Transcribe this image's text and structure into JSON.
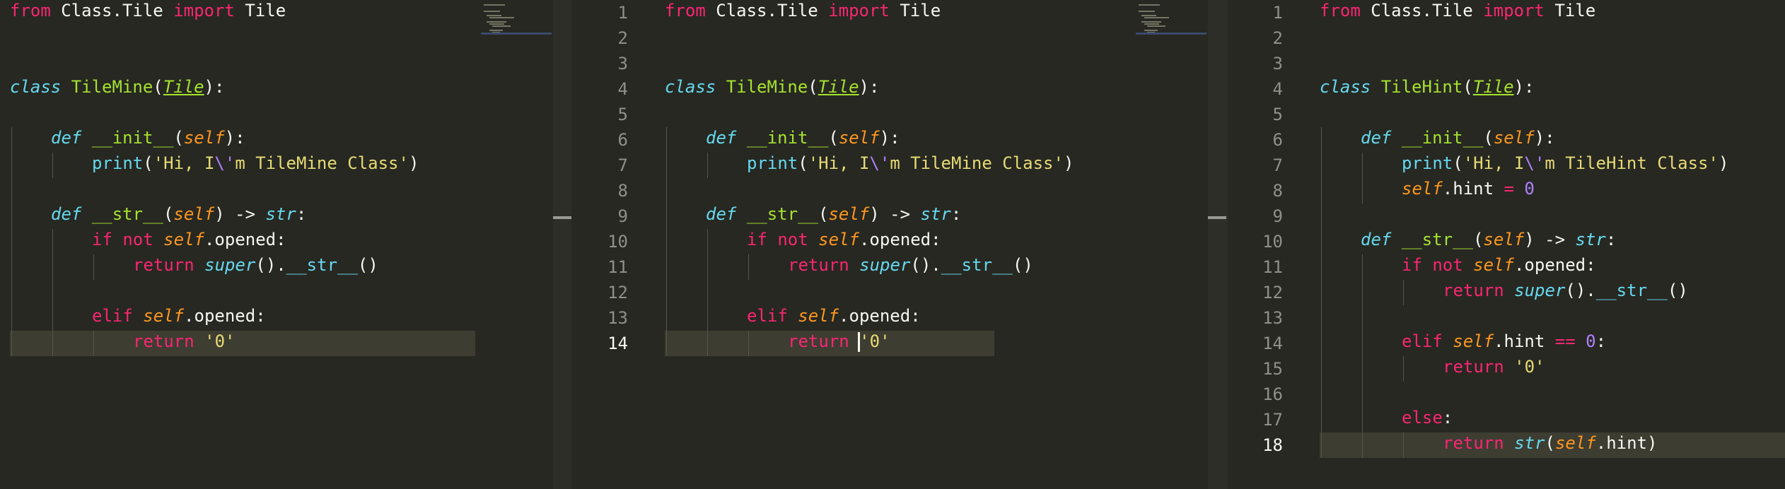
{
  "panes": [
    {
      "id": "left",
      "show_line_numbers": false,
      "line_numbers": [],
      "active_line": 14,
      "highlighted_line": 14,
      "has_minimap": true,
      "lines": [
        {
          "n": 1,
          "indent": 0,
          "tokens": [
            {
              "t": "from",
              "c": "kw"
            },
            {
              "t": " Class.Tile "
            },
            {
              "t": "import",
              "c": "kw"
            },
            {
              "t": " Tile"
            }
          ]
        },
        {
          "n": 2,
          "indent": 0,
          "tokens": []
        },
        {
          "n": 3,
          "indent": 0,
          "tokens": []
        },
        {
          "n": 4,
          "indent": 0,
          "tokens": [
            {
              "t": "class",
              "c": "st"
            },
            {
              "t": " "
            },
            {
              "t": "TileMine",
              "c": "fn"
            },
            {
              "t": "("
            },
            {
              "t": "Tile",
              "c": "inh"
            },
            {
              "t": "):"
            }
          ]
        },
        {
          "n": 5,
          "indent": 0,
          "tokens": []
        },
        {
          "n": 6,
          "indent": 1,
          "tokens": [
            {
              "t": "def",
              "c": "st"
            },
            {
              "t": " "
            },
            {
              "t": "__init__",
              "c": "fn"
            },
            {
              "t": "("
            },
            {
              "t": "self",
              "c": "prm"
            },
            {
              "t": "):"
            }
          ]
        },
        {
          "n": 7,
          "indent": 2,
          "tokens": [
            {
              "t": "print",
              "c": "bi"
            },
            {
              "t": "("
            },
            {
              "t": "'Hi, I",
              "c": "stt"
            },
            {
              "t": "\\'",
              "c": "esc"
            },
            {
              "t": "m TileMine Class'",
              "c": "stt"
            },
            {
              "t": ")"
            }
          ]
        },
        {
          "n": 8,
          "indent": 0,
          "tokens": []
        },
        {
          "n": 9,
          "indent": 1,
          "tokens": [
            {
              "t": "def",
              "c": "st"
            },
            {
              "t": " "
            },
            {
              "t": "__str__",
              "c": "fn"
            },
            {
              "t": "("
            },
            {
              "t": "self",
              "c": "prm"
            },
            {
              "t": ") -> "
            },
            {
              "t": "str",
              "c": "st"
            },
            {
              "t": ":"
            }
          ]
        },
        {
          "n": 10,
          "indent": 2,
          "tokens": [
            {
              "t": "if",
              "c": "kw"
            },
            {
              "t": " "
            },
            {
              "t": "not",
              "c": "kw"
            },
            {
              "t": " "
            },
            {
              "t": "self",
              "c": "sf"
            },
            {
              "t": ".opened:"
            }
          ]
        },
        {
          "n": 11,
          "indent": 3,
          "tokens": [
            {
              "t": "return",
              "c": "kw"
            },
            {
              "t": " "
            },
            {
              "t": "super",
              "c": "st"
            },
            {
              "t": "()."
            },
            {
              "t": "__str__",
              "c": "mag"
            },
            {
              "t": "()"
            }
          ]
        },
        {
          "n": 12,
          "indent": 0,
          "tokens": []
        },
        {
          "n": 13,
          "indent": 2,
          "tokens": [
            {
              "t": "elif",
              "c": "kw"
            },
            {
              "t": " "
            },
            {
              "t": "self",
              "c": "sf"
            },
            {
              "t": ".opened:"
            }
          ]
        },
        {
          "n": 14,
          "indent": 3,
          "tokens": [
            {
              "t": "return",
              "c": "kw"
            },
            {
              "t": " "
            },
            {
              "t": "'0'",
              "c": "stt"
            }
          ]
        }
      ]
    },
    {
      "id": "middle",
      "show_line_numbers": true,
      "line_numbers": [
        "1",
        "2",
        "3",
        "4",
        "5",
        "6",
        "7",
        "8",
        "9",
        "10",
        "11",
        "12",
        "13",
        "14"
      ],
      "active_line": 14,
      "highlighted_line": 14,
      "has_minimap": true,
      "cursor": {
        "line": 14,
        "after_token": 3,
        "offset": 1
      },
      "lines": [
        {
          "n": 1,
          "indent": 0,
          "tokens": [
            {
              "t": "from",
              "c": "kw"
            },
            {
              "t": " Class.Tile "
            },
            {
              "t": "import",
              "c": "kw"
            },
            {
              "t": " Tile"
            }
          ]
        },
        {
          "n": 2,
          "indent": 0,
          "tokens": []
        },
        {
          "n": 3,
          "indent": 0,
          "tokens": []
        },
        {
          "n": 4,
          "indent": 0,
          "tokens": [
            {
              "t": "class",
              "c": "st"
            },
            {
              "t": " "
            },
            {
              "t": "TileMine",
              "c": "fn"
            },
            {
              "t": "("
            },
            {
              "t": "Tile",
              "c": "inh"
            },
            {
              "t": "):"
            }
          ]
        },
        {
          "n": 5,
          "indent": 0,
          "tokens": []
        },
        {
          "n": 6,
          "indent": 1,
          "tokens": [
            {
              "t": "def",
              "c": "st"
            },
            {
              "t": " "
            },
            {
              "t": "__init__",
              "c": "fn"
            },
            {
              "t": "("
            },
            {
              "t": "self",
              "c": "prm"
            },
            {
              "t": "):"
            }
          ]
        },
        {
          "n": 7,
          "indent": 2,
          "tokens": [
            {
              "t": "print",
              "c": "bi"
            },
            {
              "t": "("
            },
            {
              "t": "'Hi, I",
              "c": "stt"
            },
            {
              "t": "\\'",
              "c": "esc"
            },
            {
              "t": "m TileMine Class'",
              "c": "stt"
            },
            {
              "t": ")"
            }
          ]
        },
        {
          "n": 8,
          "indent": 0,
          "tokens": []
        },
        {
          "n": 9,
          "indent": 1,
          "tokens": [
            {
              "t": "def",
              "c": "st"
            },
            {
              "t": " "
            },
            {
              "t": "__str__",
              "c": "fn"
            },
            {
              "t": "("
            },
            {
              "t": "self",
              "c": "prm"
            },
            {
              "t": ") -> "
            },
            {
              "t": "str",
              "c": "st"
            },
            {
              "t": ":"
            }
          ]
        },
        {
          "n": 10,
          "indent": 2,
          "tokens": [
            {
              "t": "if",
              "c": "kw"
            },
            {
              "t": " "
            },
            {
              "t": "not",
              "c": "kw"
            },
            {
              "t": " "
            },
            {
              "t": "self",
              "c": "sf"
            },
            {
              "t": ".opened:"
            }
          ]
        },
        {
          "n": 11,
          "indent": 3,
          "tokens": [
            {
              "t": "return",
              "c": "kw"
            },
            {
              "t": " "
            },
            {
              "t": "super",
              "c": "st"
            },
            {
              "t": "()."
            },
            {
              "t": "__str__",
              "c": "mag"
            },
            {
              "t": "()"
            }
          ]
        },
        {
          "n": 12,
          "indent": 0,
          "tokens": []
        },
        {
          "n": 13,
          "indent": 2,
          "tokens": [
            {
              "t": "elif",
              "c": "kw"
            },
            {
              "t": " "
            },
            {
              "t": "self",
              "c": "sf"
            },
            {
              "t": ".opened:"
            }
          ]
        },
        {
          "n": 14,
          "indent": 3,
          "tokens": [
            {
              "t": "return",
              "c": "kw"
            },
            {
              "t": " "
            },
            {
              "t": "'0",
              "c": "stt"
            },
            {
              "t": "'",
              "c": "stt"
            }
          ]
        }
      ]
    },
    {
      "id": "right",
      "show_line_numbers": true,
      "line_numbers": [
        "1",
        "2",
        "3",
        "4",
        "5",
        "6",
        "7",
        "8",
        "9",
        "10",
        "11",
        "12",
        "13",
        "14",
        "15",
        "16",
        "17",
        "18"
      ],
      "active_line": 18,
      "highlighted_line": 18,
      "has_minimap": false,
      "lines": [
        {
          "n": 1,
          "indent": 0,
          "tokens": [
            {
              "t": "from",
              "c": "kw"
            },
            {
              "t": " Class.Tile "
            },
            {
              "t": "import",
              "c": "kw"
            },
            {
              "t": " Tile"
            }
          ]
        },
        {
          "n": 2,
          "indent": 0,
          "tokens": []
        },
        {
          "n": 3,
          "indent": 0,
          "tokens": []
        },
        {
          "n": 4,
          "indent": 0,
          "tokens": [
            {
              "t": "class",
              "c": "st"
            },
            {
              "t": " "
            },
            {
              "t": "TileHint",
              "c": "fn"
            },
            {
              "t": "("
            },
            {
              "t": "Tile",
              "c": "inh"
            },
            {
              "t": "):"
            }
          ]
        },
        {
          "n": 5,
          "indent": 0,
          "tokens": []
        },
        {
          "n": 6,
          "indent": 1,
          "tokens": [
            {
              "t": "def",
              "c": "st"
            },
            {
              "t": " "
            },
            {
              "t": "__init__",
              "c": "fn"
            },
            {
              "t": "("
            },
            {
              "t": "self",
              "c": "prm"
            },
            {
              "t": "):"
            }
          ]
        },
        {
          "n": 7,
          "indent": 2,
          "tokens": [
            {
              "t": "print",
              "c": "bi"
            },
            {
              "t": "("
            },
            {
              "t": "'Hi, I",
              "c": "stt"
            },
            {
              "t": "\\'",
              "c": "esc"
            },
            {
              "t": "m TileHint Class'",
              "c": "stt"
            },
            {
              "t": ")"
            }
          ]
        },
        {
          "n": 8,
          "indent": 2,
          "tokens": [
            {
              "t": "self",
              "c": "sf"
            },
            {
              "t": ".hint "
            },
            {
              "t": "=",
              "c": "op"
            },
            {
              "t": " "
            },
            {
              "t": "0",
              "c": "num"
            }
          ]
        },
        {
          "n": 9,
          "indent": 0,
          "tokens": []
        },
        {
          "n": 10,
          "indent": 1,
          "tokens": [
            {
              "t": "def",
              "c": "st"
            },
            {
              "t": " "
            },
            {
              "t": "__str__",
              "c": "fn"
            },
            {
              "t": "("
            },
            {
              "t": "self",
              "c": "prm"
            },
            {
              "t": ") -> "
            },
            {
              "t": "str",
              "c": "st"
            },
            {
              "t": ":"
            }
          ]
        },
        {
          "n": 11,
          "indent": 2,
          "tokens": [
            {
              "t": "if",
              "c": "kw"
            },
            {
              "t": " "
            },
            {
              "t": "not",
              "c": "kw"
            },
            {
              "t": " "
            },
            {
              "t": "self",
              "c": "sf"
            },
            {
              "t": ".opened:"
            }
          ]
        },
        {
          "n": 12,
          "indent": 3,
          "tokens": [
            {
              "t": "return",
              "c": "kw"
            },
            {
              "t": " "
            },
            {
              "t": "super",
              "c": "st"
            },
            {
              "t": "()."
            },
            {
              "t": "__str__",
              "c": "mag"
            },
            {
              "t": "()"
            }
          ]
        },
        {
          "n": 13,
          "indent": 0,
          "tokens": []
        },
        {
          "n": 14,
          "indent": 2,
          "tokens": [
            {
              "t": "elif",
              "c": "kw"
            },
            {
              "t": " "
            },
            {
              "t": "self",
              "c": "sf"
            },
            {
              "t": ".hint "
            },
            {
              "t": "==",
              "c": "op"
            },
            {
              "t": " "
            },
            {
              "t": "0",
              "c": "num"
            },
            {
              "t": ":"
            }
          ]
        },
        {
          "n": 15,
          "indent": 3,
          "tokens": [
            {
              "t": "return",
              "c": "kw"
            },
            {
              "t": " "
            },
            {
              "t": "'0'",
              "c": "stt"
            }
          ]
        },
        {
          "n": 16,
          "indent": 0,
          "tokens": []
        },
        {
          "n": 17,
          "indent": 2,
          "tokens": [
            {
              "t": "else",
              "c": "kw"
            },
            {
              "t": ":"
            }
          ]
        },
        {
          "n": 18,
          "indent": 3,
          "tokens": [
            {
              "t": "return",
              "c": "kw"
            },
            {
              "t": " "
            },
            {
              "t": "str",
              "c": "st"
            },
            {
              "t": "("
            },
            {
              "t": "self",
              "c": "sf"
            },
            {
              "t": ".hint)"
            }
          ]
        }
      ]
    }
  ],
  "theme": {
    "background": "#272822",
    "line_highlight": "#3e3d32",
    "foreground": "#f8f8f2",
    "keyword": "#f92672",
    "storage": "#66d9ef",
    "function": "#a6e22e",
    "parameter": "#fd971f",
    "string": "#e6db74",
    "number": "#ae81ff",
    "gutter_text": "#90908a"
  }
}
